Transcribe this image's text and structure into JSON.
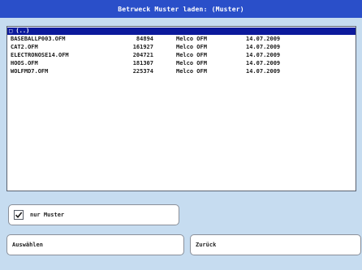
{
  "window": {
    "title": "Betrweck Muster laden: (Muster)"
  },
  "list": {
    "parent_entry": "□ (..)",
    "files": [
      {
        "name": "BASEBALLP003.OFM",
        "size": "84894",
        "type": "Melco OFM",
        "date": "14.07.2009"
      },
      {
        "name": "CAT2.OFM",
        "size": "161927",
        "type": "Melco OFM",
        "date": "14.07.2009"
      },
      {
        "name": "ELECTRONOSE14.OFM",
        "size": "204721",
        "type": "Melco OFM",
        "date": "14.07.2009"
      },
      {
        "name": "HOOS.OFM",
        "size": "181307",
        "type": "Melco OFM",
        "date": "14.07.2009"
      },
      {
        "name": "WOLFMD7.OFM",
        "size": "225374",
        "type": "Melco OFM",
        "date": "14.07.2009"
      }
    ]
  },
  "controls": {
    "only_pattern_label": "nur Muster",
    "only_pattern_checked": true,
    "select_label": "Auswählen",
    "back_label": "Zurück"
  }
}
